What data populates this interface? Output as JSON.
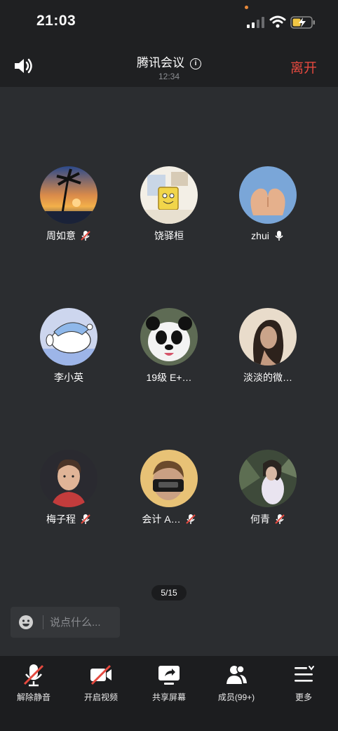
{
  "status_bar": {
    "time": "21:03"
  },
  "header": {
    "title": "腾讯会议",
    "duration": "12:34",
    "leave_label": "离开"
  },
  "participants": [
    {
      "name": "周如意",
      "mic": "muted"
    },
    {
      "name": "饶驿桓",
      "mic": "none"
    },
    {
      "name": "zhui",
      "mic": "on"
    },
    {
      "name": "李小英",
      "mic": "none"
    },
    {
      "name": "19级 E+…",
      "mic": "none"
    },
    {
      "name": "淡淡的微…",
      "mic": "none"
    },
    {
      "name": "梅子程",
      "mic": "muted"
    },
    {
      "name": "会计 A…",
      "mic": "muted"
    },
    {
      "name": "何青",
      "mic": "muted"
    }
  ],
  "pager": "5/15",
  "chat": {
    "placeholder": "说点什么..."
  },
  "toolbar": [
    {
      "label": "解除静音",
      "icon": "mic-muted-icon"
    },
    {
      "label": "开启视频",
      "icon": "camera-off-icon"
    },
    {
      "label": "共享屏幕",
      "icon": "share-screen-icon"
    },
    {
      "label": "成员(99+)",
      "icon": "members-icon"
    },
    {
      "label": "更多",
      "icon": "more-icon"
    }
  ],
  "colors": {
    "leave": "#e5493f",
    "muted_slash": "#e5493f",
    "background": "#2b2d30"
  }
}
